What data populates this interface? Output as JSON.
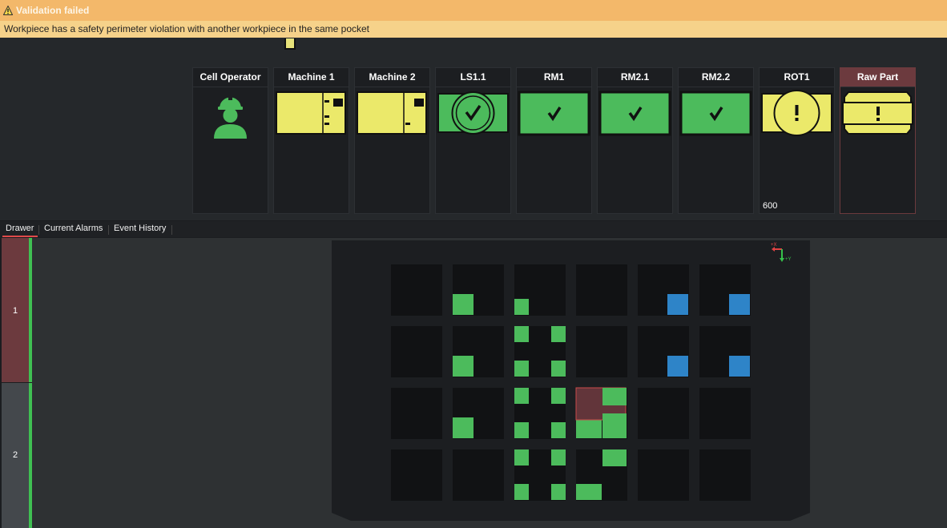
{
  "banner": {
    "title": "Validation failed",
    "message": "Workpiece has a safety perimeter violation with another workpiece in the same pocket",
    "icon": "warning-triangle-icon"
  },
  "stations": [
    {
      "label": "Cell Operator",
      "icon": "operator-icon",
      "status": "ok"
    },
    {
      "label": "Machine 1",
      "icon": "machine-icon",
      "status": "busy"
    },
    {
      "label": "Machine 2",
      "icon": "machine-icon",
      "status": "busy"
    },
    {
      "label": "LS1.1",
      "icon": "check-icon",
      "status": "ok"
    },
    {
      "label": "RM1",
      "icon": "check-icon",
      "status": "ok"
    },
    {
      "label": "RM2.1",
      "icon": "check-icon",
      "status": "ok"
    },
    {
      "label": "RM2.2",
      "icon": "check-icon",
      "status": "ok"
    },
    {
      "label": "ROT1",
      "icon": "exclamation-icon",
      "status": "warning",
      "value": "600"
    },
    {
      "label": "Raw Part",
      "icon": "exclamation-icon",
      "status": "error"
    }
  ],
  "tabs": [
    "Drawer",
    "Current Alarms",
    "Event History"
  ],
  "active_tab": "Drawer",
  "drawers": [
    {
      "label": "1",
      "selected": true
    },
    {
      "label": "2",
      "selected": false
    }
  ],
  "axis": {
    "x_label": "+X",
    "y_label": "+Y"
  },
  "colors": {
    "green": "#4cbb5c",
    "blue": "#2e84c8",
    "yellow": "#ebe96a",
    "alert_red": "#6c3a3e",
    "warning_orange": "#f3b86a"
  }
}
